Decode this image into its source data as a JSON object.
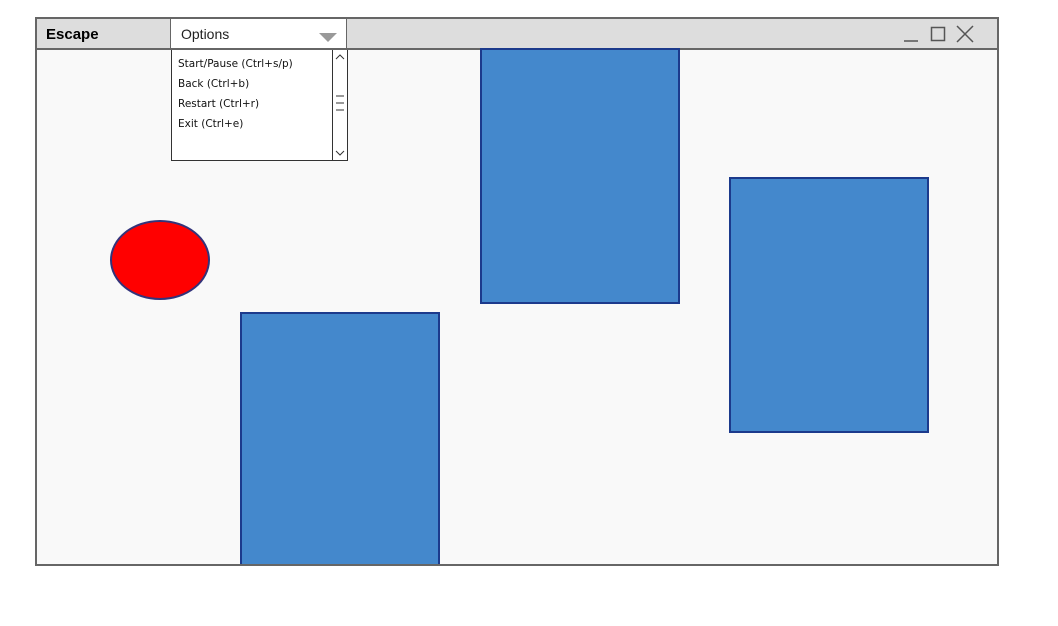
{
  "window": {
    "title": "Escape",
    "controls": {
      "minimize_icon": "minimize-icon",
      "maximize_icon": "maximize-icon",
      "close_icon": "close-icon"
    }
  },
  "options_menu": {
    "selected_label": "Options",
    "items": [
      {
        "label": "Start/Pause (Ctrl+s/p)"
      },
      {
        "label": "Back (Ctrl+b)"
      },
      {
        "label": "Restart (Ctrl+r)"
      },
      {
        "label": "Exit (Ctrl+e)"
      }
    ]
  },
  "colors": {
    "player": "#ff0000",
    "obstacle": "#4488cc",
    "obstacle_border": "#1c3a8c",
    "canvas_background": "#f9f9f9",
    "titlebar": "#dddddd"
  }
}
